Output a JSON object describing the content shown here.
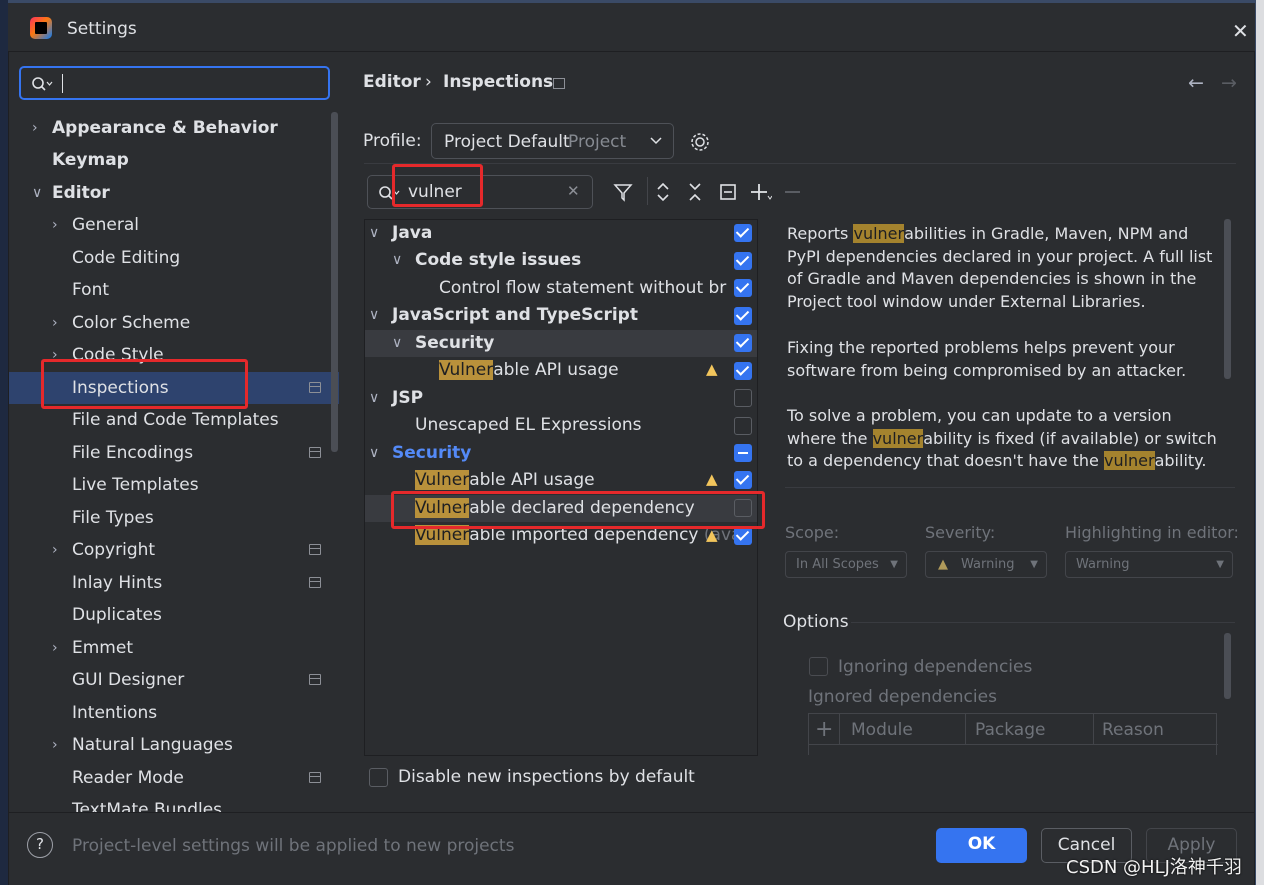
{
  "window": {
    "title": "Settings",
    "close": "✕"
  },
  "sidebar": {
    "search_value": "",
    "items": [
      {
        "label": "Appearance & Behavior"
      },
      {
        "label": "Keymap"
      },
      {
        "label": "Editor"
      },
      {
        "label": "General"
      },
      {
        "label": "Code Editing"
      },
      {
        "label": "Font"
      },
      {
        "label": "Color Scheme"
      },
      {
        "label": "Code Style"
      },
      {
        "label": "Inspections"
      },
      {
        "label": "File and Code Templates"
      },
      {
        "label": "File Encodings"
      },
      {
        "label": "Live Templates"
      },
      {
        "label": "File Types"
      },
      {
        "label": "Copyright"
      },
      {
        "label": "Inlay Hints"
      },
      {
        "label": "Duplicates"
      },
      {
        "label": "Emmet"
      },
      {
        "label": "GUI Designer"
      },
      {
        "label": "Intentions"
      },
      {
        "label": "Natural Languages"
      },
      {
        "label": "Reader Mode"
      },
      {
        "label": "TextMate Bundles"
      }
    ]
  },
  "header": {
    "crumb_parent": "Editor",
    "crumb_sep": "›",
    "crumb_current": "Inspections",
    "back": "←",
    "forward": "→"
  },
  "profile": {
    "label": "Profile:",
    "value": "Project Default",
    "scope": "Project"
  },
  "filter": {
    "value": "vulner"
  },
  "tree": {
    "java": "Java",
    "code_style_issues": "Code style issues",
    "control_flow": "Control flow statement without br",
    "js_ts": "JavaScript and TypeScript",
    "security": "Security",
    "vuln_api_prefix": "Vulner",
    "vuln_api_rest": "able API usage",
    "jsp": "JSP",
    "unescaped_el": "Unescaped EL Expressions",
    "security_top": "Security",
    "vuln_declared_rest": "able declared dependency",
    "vuln_imported_rest": "able imported dependency",
    "vuln_imported_tail": "(ava"
  },
  "description": {
    "p1_a": "Reports ",
    "p1_hl": "vulner",
    "p1_b": "abilities in Gradle, Maven, NPM and PyPI dependencies declared in your project. A full list of Gradle and Maven dependencies is shown in the Project tool window under External Libraries.",
    "p2": "Fixing the reported problems helps prevent your software from being compromised by an attacker.",
    "p3_a": "To solve a problem, you can update to a version where the ",
    "p3_hl1": "vulner",
    "p3_b": "ability is fixed (if available) or switch to a dependency that doesn't have the ",
    "p3_hl2": "vulner",
    "p3_c": "ability."
  },
  "settings_panel": {
    "scope_label": "Scope:",
    "severity_label": "Severity:",
    "highlight_label": "Highlighting in editor:",
    "scope_value": "In All Scopes",
    "severity_value": "Warning",
    "highlight_value": "Warning",
    "options_label": "Options",
    "ignoring_deps": "Ignoring dependencies",
    "ignored_deps": "Ignored dependencies",
    "col_module": "Module",
    "col_package": "Package",
    "col_reason": "Reason",
    "add": "+"
  },
  "disable_new": "Disable new inspections by default",
  "footer": {
    "help": "?",
    "note": "Project-level settings will be applied to new projects",
    "ok": "OK",
    "cancel": "Cancel",
    "apply": "Apply"
  },
  "watermark": "CSDN @HLJ洛神千羽",
  "colors": {
    "accent": "#3574f0",
    "highlight_box": "#e5292b",
    "match_highlight": "#b9913b"
  }
}
